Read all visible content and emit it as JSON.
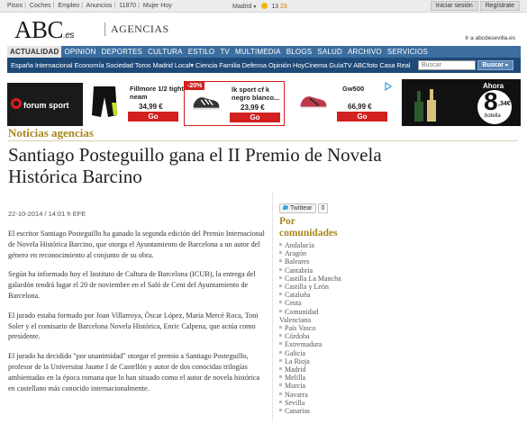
{
  "topbar": {
    "links": [
      "Pisos",
      "Coches",
      "Empleo",
      "Anuncios",
      "11870",
      "Mujer Hoy"
    ],
    "city": "Madrid",
    "temp_low": "13",
    "temp_high": "23",
    "login": "Iniciar sesión",
    "register": "Regístrate"
  },
  "masthead": {
    "logo": "ABC",
    "logo_suffix": ".es",
    "section": "AGENCIAS",
    "ir_link": "Ir a abcdesevilla.es"
  },
  "nav": {
    "items": [
      "ACTUALIDAD",
      "OPINIÓN",
      "DEPORTES",
      "CULTURA",
      "ESTILO",
      "TV",
      "MULTIMEDIA",
      "BLOGS",
      "SALUD",
      "ARCHIVO",
      "SERVICIOS"
    ],
    "active_index": 0
  },
  "subnav": {
    "items": "España Internacional Economía Sociedad Toros Madrid Local▾ Ciencia Familia Defensa Opinión HoyCinema GuíaTV ABCfoto Casa Real",
    "search_placeholder": "Buscar",
    "search_button": "Buscar ▸"
  },
  "ad": {
    "brand": "forum sport",
    "products": [
      {
        "name": "Fillmore 1/2 tight neam",
        "price": "34,99 €",
        "button": "Go"
      },
      {
        "name": "lk sport cf k negro blanco...",
        "price": "23,99 €",
        "button": "Go",
        "badge": "-20%"
      },
      {
        "name": "Gw500",
        "price": "66,99 €",
        "button": "Go"
      }
    ],
    "beer": {
      "ahora": "Ahora",
      "price_big": "8",
      "price_small": ",34€",
      "unit": "botella"
    }
  },
  "article": {
    "kicker": "Noticias agencias",
    "headline": "Santiago Posteguillo gana el II Premio de Novela Histórica Barcino",
    "dateline": "22-10-2014 / 14:01 h EFE",
    "tweet_label": "Twittear",
    "tweet_count": "0",
    "paragraphs": [
      "El escritor Santiago Posteguillo ha ganado la segunda edición del Premio Internacional de Novela Histórica Barcino, que otorga el Ayuntamiento de Barcelona a un autor del género en reconocimiento al conjunto de su obra.",
      "Según ha informado hoy el Instituto de Cultura de Barcelona (ICUB), la entrega del galardón tendrá lugar el 20 de noviembre en el Saló de Cent del Ayuntamiento de Barcelona.",
      "El jurado estaba formado por Joan Villarroya, Òscar López, Maria Mercè Roca, Toni Soler y el comisario de Barcelona Novela Histórica, Enric Calpena, que actúa como presidente.",
      "El jurado ha decidido \"por unanimidad\" otorgar el premio a Santiago Posteguillo, profesor de la Universitat Jaume I de Castellón y autor de dos conocidas trilogías ambientadas en la época romana que lo han situado como el autor de novela histórica en castellano más conocido internacionalmente."
    ]
  },
  "sidebar": {
    "title": "Por comunidades",
    "items": [
      "Andalucía",
      "Aragón",
      "Baleares",
      "Cantabria",
      "Castilla La Mancha",
      "Castilla y León",
      "Cataluña",
      "Ceuta",
      "Comunidad Valenciana",
      "País Vasco",
      "Córdoba",
      "Extremadura",
      "Galicia",
      "La Rioja",
      "Madrid",
      "Melilla",
      "Murcia",
      "Navarra",
      "Sevilla",
      "Canarias"
    ]
  },
  "colors": {
    "nav_blue": "#3c6ea0",
    "subnav_blue": "#1d4a78",
    "accent_gold": "#a8861c",
    "ad_red": "#d32020"
  }
}
